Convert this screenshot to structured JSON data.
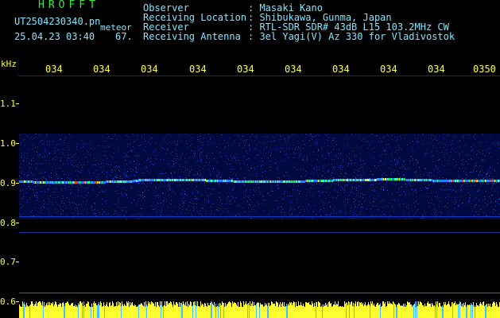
{
  "header": {
    "logo": "HROFFT",
    "filename": "UT2504230340.pn",
    "file_tag": "meteor",
    "datetime": "25.04.23 03:40",
    "level_value": "67.",
    "observer_label": "Observer",
    "observer_value": ": Masaki Kano",
    "location_label": "Receiving Location",
    "location_value": ": Shibukawa, Gunma, Japan",
    "receiver_label": "Receiver",
    "receiver_value": ": RTL-SDR SDR# 43dB L15 103.2MHz CW",
    "antenna_label": "Receiving Antenna",
    "antenna_value": ": 3el Yagi(V) Az 330 for Vladivostok"
  },
  "axes": {
    "y_unit": "kHz",
    "time_ticks": [
      "034",
      "034",
      "034",
      "034",
      "034",
      "034",
      "034",
      "034",
      "034",
      "0350"
    ],
    "freq_ticks": [
      "1.1",
      "1.0",
      "0.9",
      "0.8",
      "0.7",
      "0.6"
    ]
  },
  "colors": {
    "background": "#000000",
    "title_green": "#38e838",
    "header_cyan": "#7fe6ff",
    "axis_yellow": "#ffff3a",
    "noise_blue": "#1030e0",
    "signal_green": "#30ff60",
    "signal_red": "#ff3020"
  }
}
